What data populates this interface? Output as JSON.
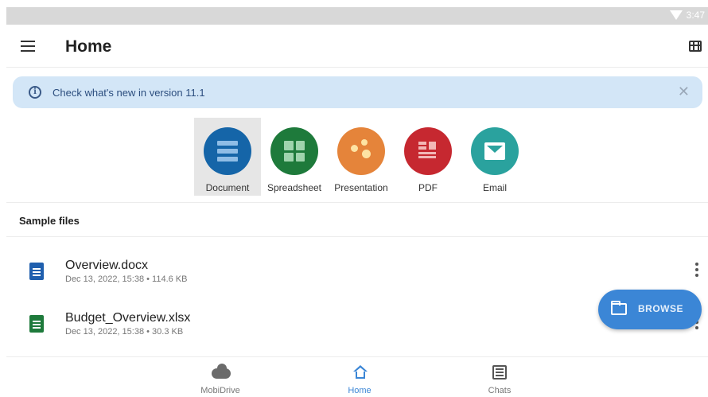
{
  "status_bar": {
    "time": "3:47"
  },
  "app_bar": {
    "title": "Home"
  },
  "banner": {
    "text": "Check what's new in version 11.1",
    "close_glyph": "✕"
  },
  "create": [
    {
      "label": "Document",
      "color": "#1565a8",
      "icon": "document-icon",
      "selected": true
    },
    {
      "label": "Spreadsheet",
      "color": "#1e7a3b",
      "icon": "spreadsheet-icon"
    },
    {
      "label": "Presentation",
      "color": "#e5843a",
      "icon": "presentation-icon"
    },
    {
      "label": "PDF",
      "color": "#c62830",
      "icon": "pdf-icon"
    },
    {
      "label": "Email",
      "color": "#2aa29e",
      "icon": "email-icon"
    }
  ],
  "sample_files": {
    "title": "Sample files",
    "items": [
      {
        "name": "Overview.docx",
        "meta": "Dec 13, 2022, 15:38 • 114.6 KB",
        "icon": "docx-file-icon",
        "color": "#1f5fae"
      },
      {
        "name": "Budget_Overview.xlsx",
        "meta": "Dec 13, 2022, 15:38 • 30.3 KB",
        "icon": "xlsx-file-icon",
        "color": "#1e7a3b"
      }
    ]
  },
  "fab": {
    "label": "BROWSE",
    "icon": "folder-icon"
  },
  "bottom_nav": [
    {
      "label": "MobiDrive",
      "icon": "cloud-icon"
    },
    {
      "label": "Home",
      "icon": "home-icon",
      "active": true
    },
    {
      "label": "Chats",
      "icon": "chats-icon"
    }
  ]
}
